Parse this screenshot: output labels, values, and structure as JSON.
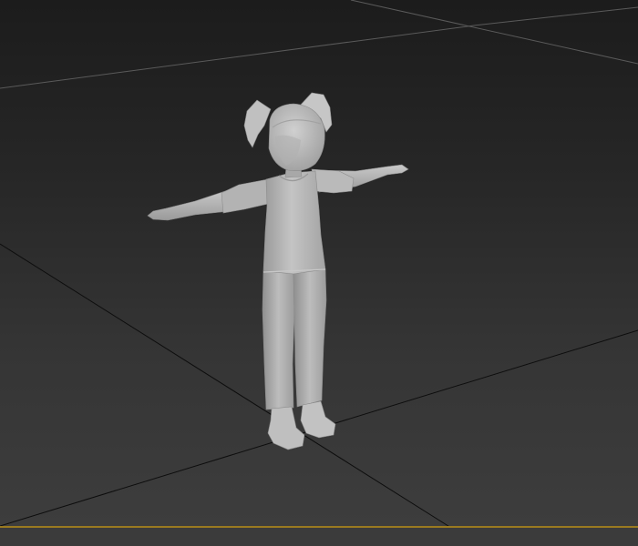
{
  "viewport": {
    "background_top": "#1c1c1c",
    "background_bottom": "#3e3e3e",
    "grid_line_color": "#0d0d0d",
    "grid_line_far_color": "#5a5a5a",
    "active_frame_color": "#9a7a20"
  },
  "model": {
    "pose": "t-pose",
    "shading": "gray clay",
    "base_color": "#b9b9b9",
    "shadow_color": "#8e8e8e",
    "highlight_color": "#d2d2d2"
  }
}
